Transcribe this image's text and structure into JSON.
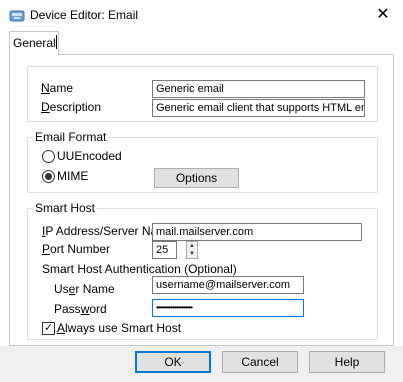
{
  "window": {
    "title": "Device Editor: Email",
    "icon": "device-editor-app-icon",
    "close_glyph": "✕"
  },
  "tabs": [
    {
      "label": "General",
      "active": true
    }
  ],
  "identity": {
    "name_label": "Name",
    "name_value": "Generic email",
    "description_label": "Description",
    "description_value": "Generic email client that supports HTML email. Work"
  },
  "email_format": {
    "title": "Email Format",
    "options": [
      {
        "label": "UUEncoded",
        "selected": false
      },
      {
        "label": "MIME",
        "selected": true
      }
    ],
    "options_button": "Options"
  },
  "smart_host": {
    "title": "Smart Host",
    "ip_label": "IP Address/Server Name",
    "ip_value": "mail.mailserver.com",
    "port_label": "Port Number",
    "port_value": "25",
    "auth_label": "Smart Host Authentication (Optional)",
    "user_label": "User Name",
    "user_value": "username@mailserver.com",
    "password_label": "Password",
    "password_value": "••••••••••••••••••••",
    "always_use_label": "Always use Smart Host",
    "always_use_checked": true
  },
  "footer": {
    "ok": "OK",
    "cancel": "Cancel",
    "help": "Help"
  },
  "colors": {
    "accent": "#0078d7",
    "footer_bg": "#f0f0f0"
  }
}
